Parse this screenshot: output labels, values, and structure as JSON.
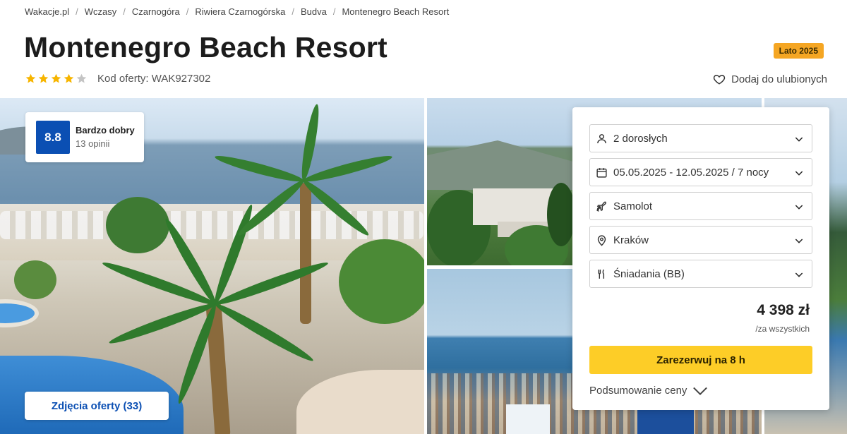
{
  "breadcrumb": [
    "Wakacje.pl",
    "Wczasy",
    "Czarnogóra",
    "Riwiera Czarnogórska",
    "Budva",
    "Montenegro Beach Resort"
  ],
  "hotel": {
    "name": "Montenegro Beach Resort",
    "stars": 4,
    "max_stars": 5,
    "offer_code": "Kod oferty: WAK927302",
    "season_badge": "Lato 2025",
    "favorite_label": "Dodaj do ulubionych"
  },
  "rating": {
    "score": "8.8",
    "label": "Bardzo dobry",
    "count": "13 opinii"
  },
  "gallery": {
    "photos_button": "Zdjęcia oferty (33)"
  },
  "booking": {
    "fields": [
      {
        "icon": "person-icon",
        "value": "2 dorosłych"
      },
      {
        "icon": "calendar-icon",
        "value": "05.05.2025 - 12.05.2025 / 7 nocy"
      },
      {
        "icon": "plane-icon",
        "value": "Samolot"
      },
      {
        "icon": "location-pin-icon",
        "value": "Kraków"
      },
      {
        "icon": "cutlery-icon",
        "value": "Śniadania (BB)"
      }
    ],
    "price": "4 398 zł",
    "price_note": "/za wszystkich",
    "book_button": "Zarezerwuj na 8 h",
    "summary_label": "Podsumowanie ceny"
  },
  "colors": {
    "brand_blue": "#0b4fb3",
    "accent_yellow": "#fdcd27",
    "badge_orange": "#f5a623",
    "star_yellow": "#f7b500"
  }
}
